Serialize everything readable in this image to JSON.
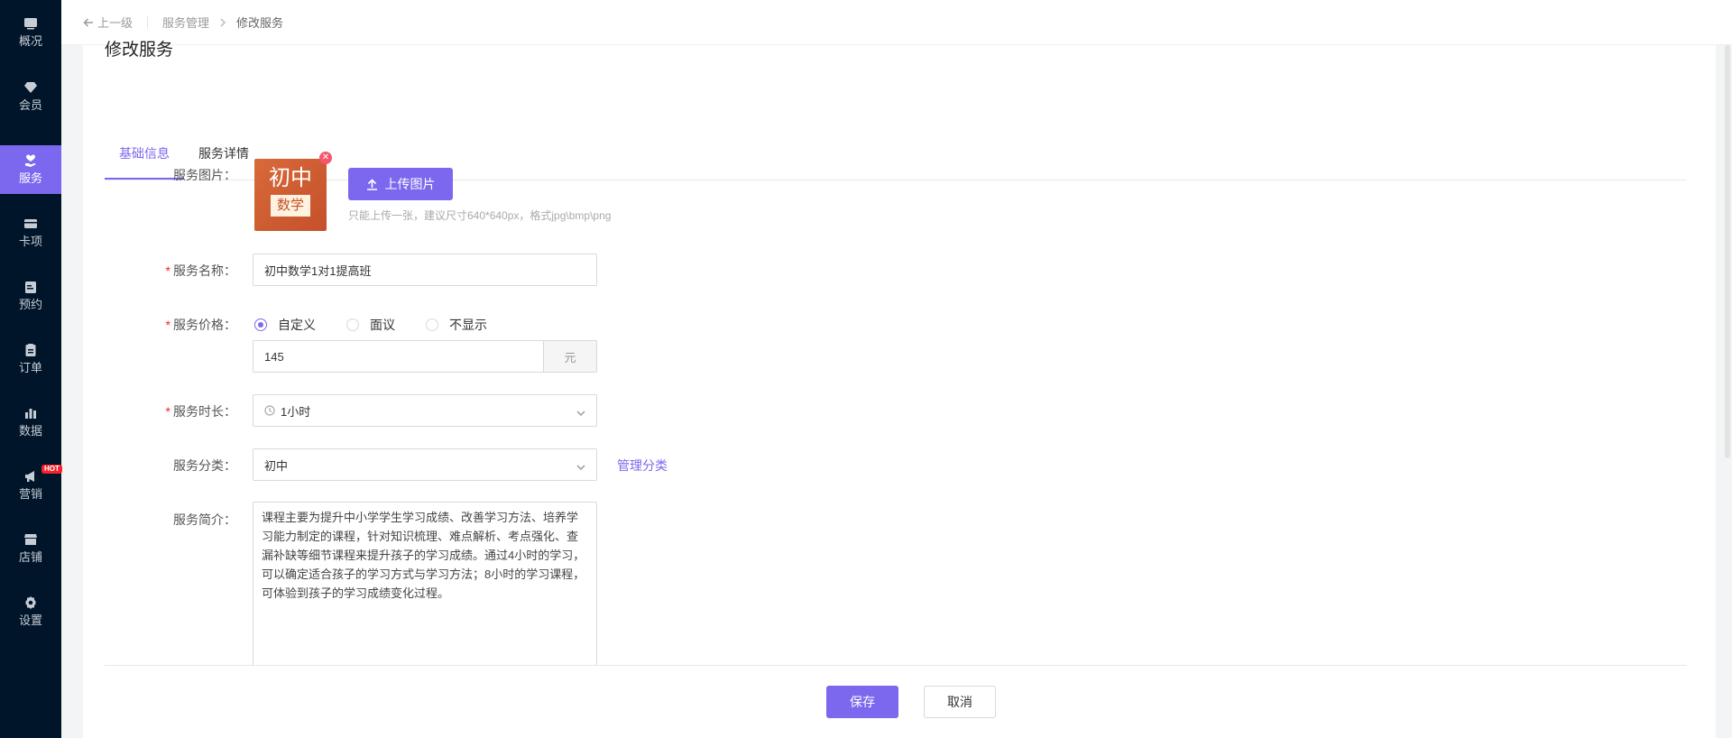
{
  "sidebar": {
    "items": [
      {
        "label": "概况",
        "icon": "dashboard-icon"
      },
      {
        "label": "会员",
        "icon": "diamond-icon"
      },
      {
        "label": "服务",
        "icon": "heart-hand-icon",
        "active": true
      },
      {
        "label": "卡项",
        "icon": "card-icon"
      },
      {
        "label": "预约",
        "icon": "calendar-icon"
      },
      {
        "label": "订单",
        "icon": "clipboard-icon"
      },
      {
        "label": "数据",
        "icon": "bar-chart-icon"
      },
      {
        "label": "营销",
        "icon": "megaphone-icon",
        "badge": "HOT"
      },
      {
        "label": "店铺",
        "icon": "store-icon"
      },
      {
        "label": "设置",
        "icon": "gear-icon"
      }
    ]
  },
  "topbar": {
    "back_label": "上一级",
    "breadcrumb": [
      "服务管理",
      "修改服务"
    ]
  },
  "page": {
    "title": "修改服务"
  },
  "tabs": [
    {
      "label": "基础信息",
      "active": true
    },
    {
      "label": "服务详情",
      "active": false
    }
  ],
  "form": {
    "image": {
      "label": "服务图片：",
      "thumb_top": "初中",
      "thumb_bottom": "数学",
      "upload_label": "上传图片",
      "hint": "只能上传一张，建议尺寸640*640px，格式jpg\\bmp\\png"
    },
    "name": {
      "label": "服务名称：",
      "value": "初中数学1对1提高班",
      "required": true
    },
    "price": {
      "label": "服务价格：",
      "required": true,
      "options": [
        "自定义",
        "面议",
        "不显示"
      ],
      "selected": "自定义",
      "value": "145",
      "unit": "元"
    },
    "duration": {
      "label": "服务时长：",
      "value": "1小时",
      "required": true
    },
    "category": {
      "label": "服务分类：",
      "value": "初中",
      "manage_label": "管理分类"
    },
    "intro": {
      "label": "服务简介：",
      "value": "课程主要为提升中小学学生学习成绩、改善学习方法、培养学习能力制定的课程，针对知识梳理、难点解析、考点强化、查漏补缺等细节课程来提升孩子的学习成绩。通过4小时的学习，可以确定适合孩子的学习方式与学习方法；8小时的学习课程，可体验到孩子的学习成绩变化过程。"
    }
  },
  "footer": {
    "save_label": "保存",
    "cancel_label": "取消"
  },
  "colors": {
    "accent": "#7b68ee",
    "sidebar_bg": "#001529",
    "required": "#f5222d"
  }
}
